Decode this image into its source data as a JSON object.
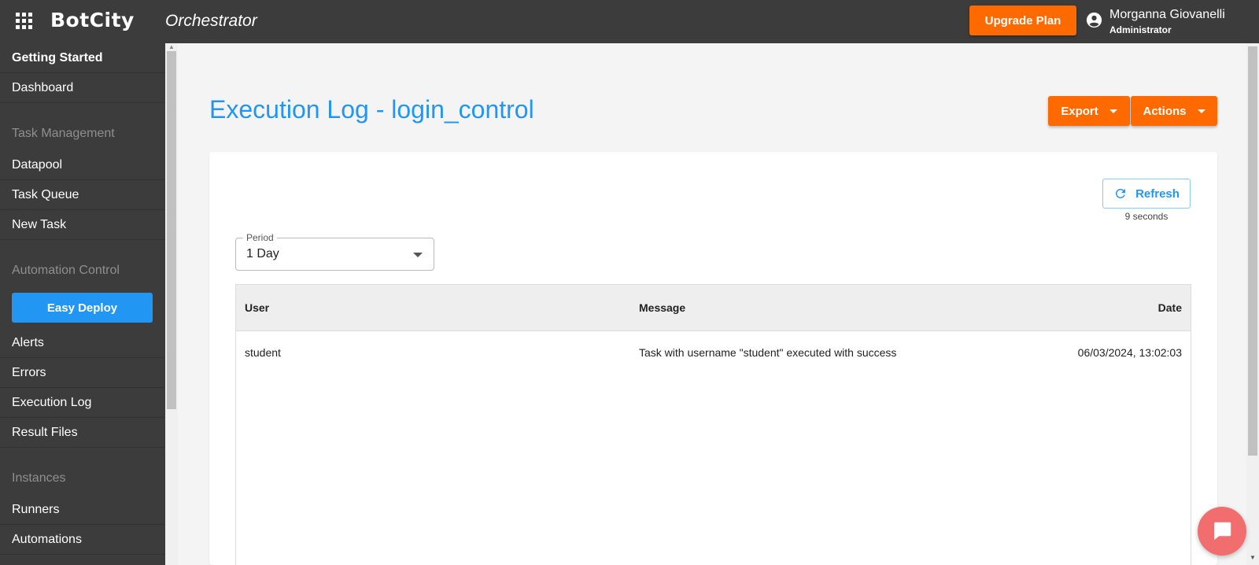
{
  "header": {
    "logo": "BotCity",
    "product": "Orchestrator",
    "upgrade_label": "Upgrade Plan",
    "user": {
      "name": "Morganna Giovanelli",
      "role": "Administrator"
    }
  },
  "sidebar": {
    "getting_started": "Getting Started",
    "dashboard": "Dashboard",
    "sections": {
      "task_management": "Task Management",
      "automation_control": "Automation Control",
      "instances": "Instances"
    },
    "items": {
      "datapool": "Datapool",
      "task_queue": "Task Queue",
      "new_task": "New Task",
      "easy_deploy": "Easy Deploy",
      "alerts": "Alerts",
      "errors": "Errors",
      "execution_log": "Execution Log",
      "result_files": "Result Files",
      "runners": "Runners",
      "automations": "Automations"
    }
  },
  "main": {
    "title": "Execution Log - login_control",
    "export_label": "Export",
    "actions_label": "Actions",
    "refresh_label": "Refresh",
    "refresh_interval": "9 seconds",
    "period": {
      "label": "Period",
      "value": "1 Day"
    },
    "table": {
      "columns": [
        "User",
        "Message",
        "Date"
      ],
      "rows": [
        {
          "user": "student",
          "message": "Task with username \"student\" executed with success",
          "date": "06/03/2024, 13:02:03"
        }
      ]
    }
  },
  "colors": {
    "accent_orange": "#ff6a00",
    "accent_blue": "#2196f3",
    "sidebar_bg": "#3c3c3c",
    "chat_red": "#f26d6d"
  }
}
